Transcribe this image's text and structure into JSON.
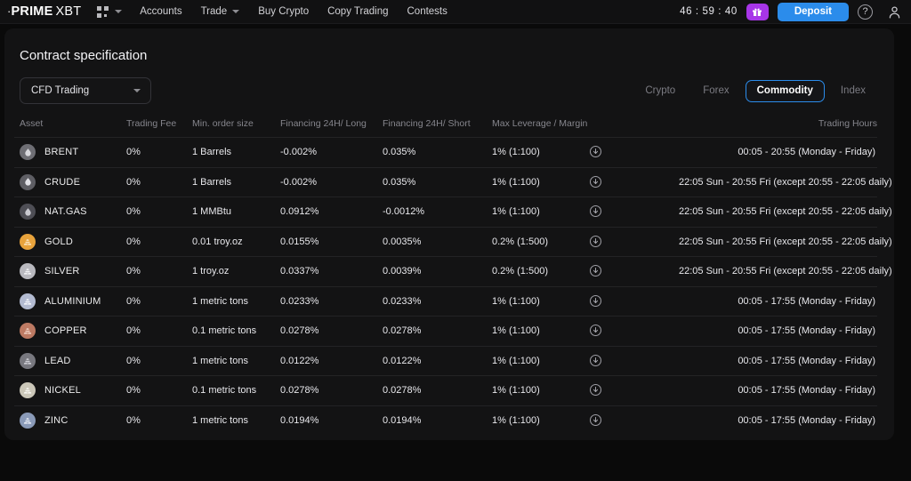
{
  "navbar": {
    "logo": {
      "dot": "·",
      "bold": "PRIME",
      "thin": "XBT"
    },
    "grid_icon": "apps-grid-icon",
    "links": [
      {
        "label": "Accounts",
        "has_caret": false
      },
      {
        "label": "Trade",
        "has_caret": true
      },
      {
        "label": "Buy Crypto",
        "has_caret": false
      },
      {
        "label": "Copy Trading",
        "has_caret": false
      },
      {
        "label": "Contests",
        "has_caret": false
      }
    ],
    "timer": "46 : 59 : 40",
    "gift_icon": "gift-icon",
    "gift_color": "#a735e8",
    "deposit_label": "Deposit",
    "deposit_color": "#2b8ceb",
    "help_icon": "question-mark-icon",
    "help_label": "?",
    "account_icon": "user-avatar-icon"
  },
  "page": {
    "title": "Contract specification",
    "account_select": {
      "value": "CFD Trading",
      "caret": "chevron-down-icon"
    },
    "tabs": [
      {
        "label": "Crypto",
        "active": false
      },
      {
        "label": "Forex",
        "active": false
      },
      {
        "label": "Commodity",
        "active": true
      },
      {
        "label": "Index",
        "active": false
      }
    ],
    "active_tab_color": "#2b8ceb"
  },
  "table": {
    "columns": [
      "Asset",
      "Trading Fee",
      "Min. order size",
      "Financing 24H/ Long",
      "Financing 24H/ Short",
      "Max Leverage / Margin",
      "",
      "Trading Hours"
    ],
    "rows": [
      {
        "asset": "BRENT",
        "icon": "oil-drop-icon",
        "icon_bg": "#6e6e74",
        "icon_fg": "#d8d8dd",
        "fee": "0%",
        "size": "1 Barrels",
        "long": "-0.002%",
        "short": "0.035%",
        "leverage": "1% (1:100)",
        "info": "info-download-icon",
        "hours": "00:05 - 20:55 (Monday - Friday)"
      },
      {
        "asset": "CRUDE",
        "icon": "oil-drop-icon",
        "icon_bg": "#5e5e64",
        "icon_fg": "#e2e2e7",
        "fee": "0%",
        "size": "1 Barrels",
        "long": "-0.002%",
        "short": "0.035%",
        "leverage": "1% (1:100)",
        "info": "info-download-icon",
        "hours": "22:05 Sun - 20:55 Fri (except 20:55 - 22:05 daily)"
      },
      {
        "asset": "NAT.GAS",
        "icon": "flame-icon",
        "icon_bg": "#4e4e55",
        "icon_fg": "#c9c9d0",
        "fee": "0%",
        "size": "1 MMBtu",
        "long": "0.0912%",
        "short": "-0.0012%",
        "leverage": "1% (1:100)",
        "info": "info-download-icon",
        "hours": "22:05 Sun - 20:55 Fri (except 20:55 - 22:05 daily)"
      },
      {
        "asset": "GOLD",
        "icon": "gold-bars-icon",
        "icon_bg": "#e8a33c",
        "icon_fg": "#fbe3bd",
        "fee": "0%",
        "size": "0.01 troy.oz",
        "long": "0.0155%",
        "short": "0.0035%",
        "leverage": "0.2% (1:500)",
        "info": "info-download-icon",
        "hours": "22:05 Sun - 20:55 Fri (except 20:55 - 22:05 daily)"
      },
      {
        "asset": "SILVER",
        "icon": "silver-bars-icon",
        "icon_bg": "#b9b9bf",
        "icon_fg": "#f2f2f5",
        "fee": "0%",
        "size": "1 troy.oz",
        "long": "0.0337%",
        "short": "0.0039%",
        "leverage": "0.2% (1:500)",
        "info": "info-download-icon",
        "hours": "22:05 Sun - 20:55 Fri (except 20:55 - 22:05 daily)"
      },
      {
        "asset": "ALUMINIUM",
        "icon": "aluminium-bar-icon",
        "icon_bg": "#b3bbd1",
        "icon_fg": "#f3f5fb",
        "fee": "0%",
        "size": "1 metric tons",
        "long": "0.0233%",
        "short": "0.0233%",
        "leverage": "1% (1:100)",
        "info": "info-download-icon",
        "hours": "00:05 - 17:55 (Monday - Friday)"
      },
      {
        "asset": "COPPER",
        "icon": "copper-bars-icon",
        "icon_bg": "#bd7a63",
        "icon_fg": "#f0cfc2",
        "fee": "0%",
        "size": "0.1 metric tons",
        "long": "0.0278%",
        "short": "0.0278%",
        "leverage": "1% (1:100)",
        "info": "info-download-icon",
        "hours": "00:05 - 17:55 (Monday - Friday)"
      },
      {
        "asset": "LEAD",
        "icon": "lead-bar-icon",
        "icon_bg": "#78787f",
        "icon_fg": "#cfcfd6",
        "fee": "0%",
        "size": "1 metric tons",
        "long": "0.0122%",
        "short": "0.0122%",
        "leverage": "1% (1:100)",
        "info": "info-download-icon",
        "hours": "00:05 - 17:55 (Monday - Friday)"
      },
      {
        "asset": "NICKEL",
        "icon": "nickel-bar-icon",
        "icon_bg": "#cbc7b9",
        "icon_fg": "#f7f6f1",
        "fee": "0%",
        "size": "0.1 metric tons",
        "long": "0.0278%",
        "short": "0.0278%",
        "leverage": "1% (1:100)",
        "info": "info-download-icon",
        "hours": "00:05 - 17:55 (Monday - Friday)"
      },
      {
        "asset": "ZINC",
        "icon": "zinc-bars-icon",
        "icon_bg": "#8a9ab8",
        "icon_fg": "#e6ebf5",
        "fee": "0%",
        "size": "1 metric tons",
        "long": "0.0194%",
        "short": "0.0194%",
        "leverage": "1% (1:100)",
        "info": "info-download-icon",
        "hours": "00:05 - 17:55 (Monday - Friday)"
      }
    ]
  }
}
